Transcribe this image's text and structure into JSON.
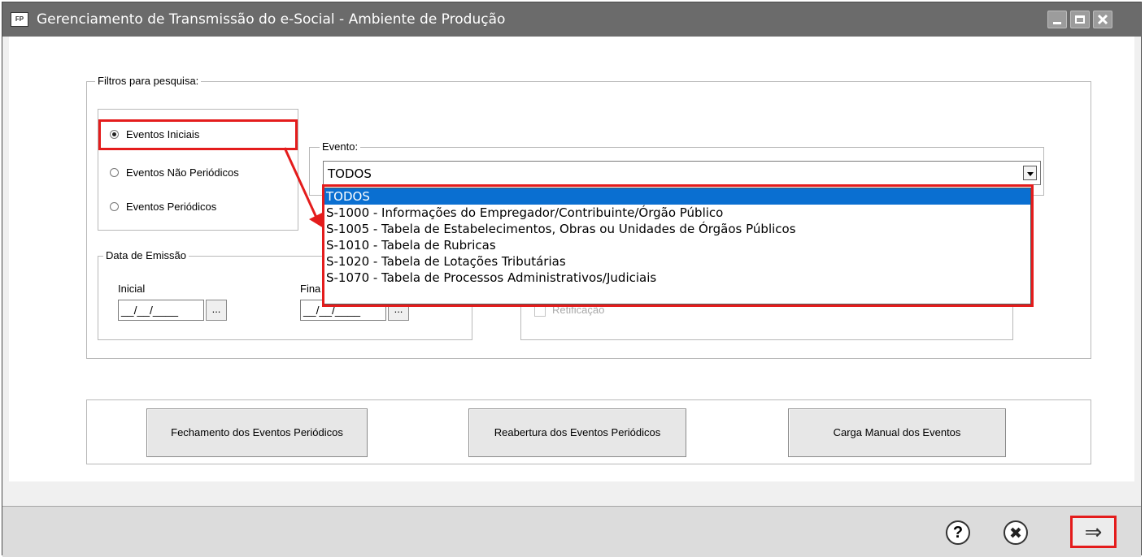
{
  "window": {
    "icon_label": "FP",
    "title": "Gerenciamento de Transmissão do e-Social - Ambiente de Produção"
  },
  "filters": {
    "legend": "Filtros para pesquisa:",
    "radio_options": [
      {
        "label": "Eventos Iniciais",
        "selected": true
      },
      {
        "label": "Eventos Não Periódicos",
        "selected": false
      },
      {
        "label": "Eventos Periódicos",
        "selected": false
      }
    ],
    "evento": {
      "legend": "Evento:",
      "value": "TODOS",
      "options": [
        "TODOS",
        "S-1000 - Informações do Empregador/Contribuinte/Órgão Público",
        "S-1005 - Tabela de Estabelecimentos, Obras ou Unidades de Órgãos Públicos",
        "S-1010 - Tabela de Rubricas",
        "S-1020 - Tabela de Lotações Tributárias",
        "S-1070 - Tabela de Processos Administrativos/Judiciais"
      ]
    },
    "data_emissao": {
      "legend": "Data de Emissão",
      "inicial_label": "Inicial",
      "final_label": "Fina",
      "inicial_value": "__/__/____",
      "final_value": "__/__/____",
      "picker_label": "..."
    },
    "retificacao_label": "Retificação"
  },
  "actions": {
    "fechamento": "Fechamento dos Eventos Periódicos",
    "reabertura": "Reabertura dos Eventos Periódicos",
    "carga": "Carga Manual dos Eventos"
  },
  "footer": {
    "help_glyph": "?",
    "next_glyph": "⇒"
  },
  "colors": {
    "highlight": "#e41c1c",
    "selection": "#0a6fd1",
    "titlebar": "#6b6b6b"
  }
}
